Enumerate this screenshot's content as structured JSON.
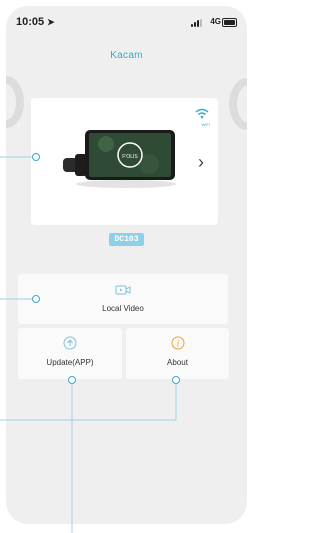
{
  "status": {
    "time": "10:05",
    "location_icon": "location-arrow-icon",
    "network": "4G"
  },
  "header": {
    "title": "Kacam"
  },
  "device": {
    "model": "DC103",
    "wifi_label": "WIFI",
    "screen_logo": "F'OLIS",
    "chevron_icon": "chevron-right-icon"
  },
  "menu": {
    "local_video": "Local Video",
    "update": "Update(APP)",
    "about": "About"
  },
  "colors": {
    "accent": "#3aa9c9",
    "badge": "#8fd0e6",
    "about_icon": "#e8a33a",
    "background": "#efefef"
  }
}
